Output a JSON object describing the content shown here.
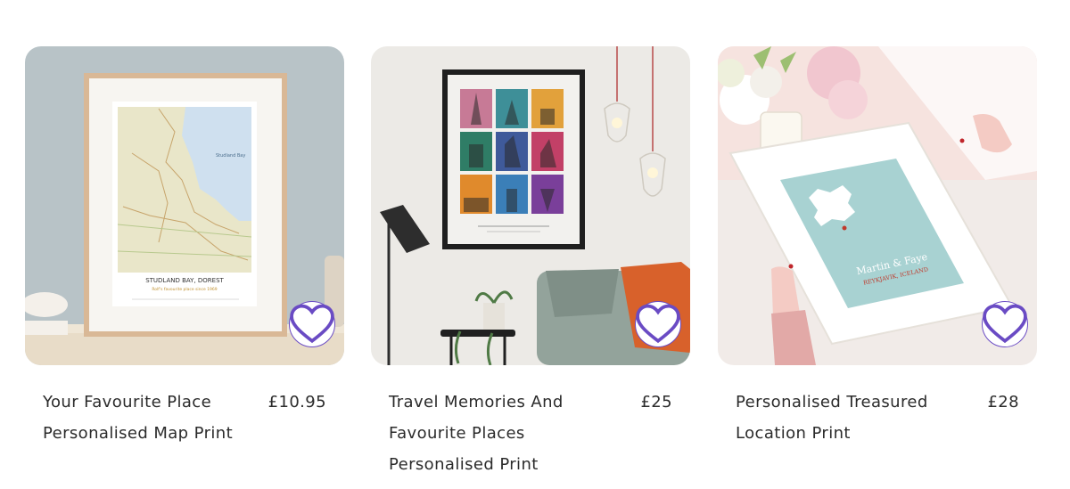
{
  "products": [
    {
      "title": "Your Favourite Place Personalised Map Print",
      "price": "£10.95",
      "image_icon": "framed-map-print-image",
      "image_text": {
        "place": "STUDLAND BAY, DOREST",
        "caption": "Rolf's favourite place since 1969",
        "region": "Studland Bay"
      }
    },
    {
      "title": "Travel Memories And Favourite Places Personalised Print",
      "price": "£25",
      "image_icon": "framed-travel-poster-image"
    },
    {
      "title": "Personalised Treasured Location Print",
      "price": "£28",
      "image_icon": "framed-location-print-image",
      "image_text": {
        "names": "Martin & Faye",
        "location": "REYKJAVIK, ICELAND"
      }
    }
  ],
  "favourite_icon": "heart-outline-icon",
  "colors": {
    "accent": "#6a4bc4",
    "text": "#2b2b2b"
  }
}
